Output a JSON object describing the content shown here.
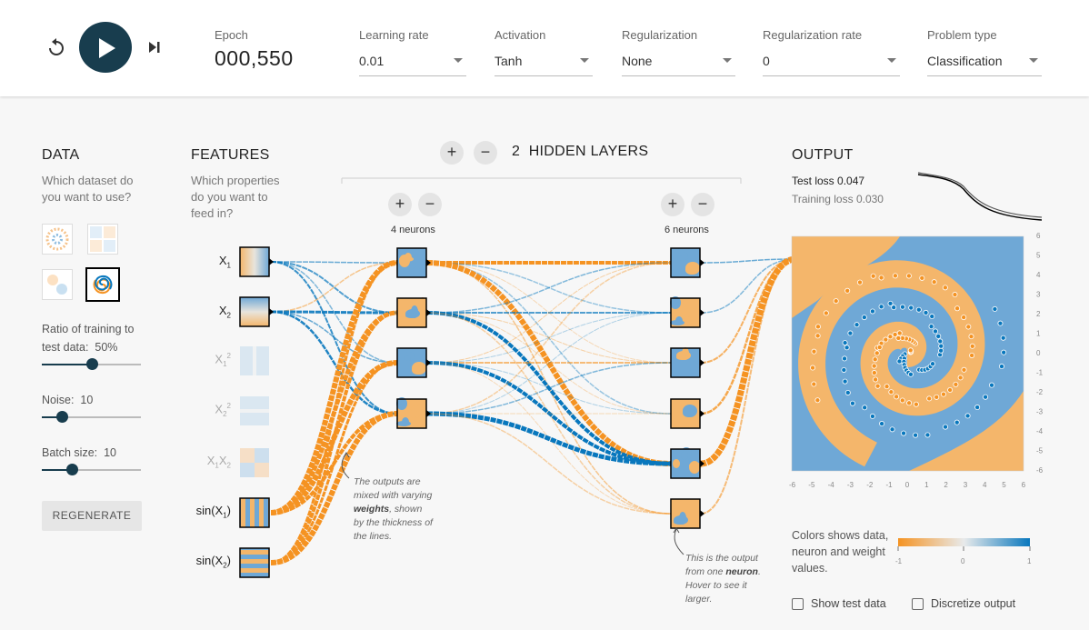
{
  "controls": {
    "epoch_label": "Epoch",
    "epoch_value": "000,550",
    "learning_rate": {
      "label": "Learning rate",
      "value": "0.01"
    },
    "activation": {
      "label": "Activation",
      "value": "Tanh"
    },
    "regularization": {
      "label": "Regularization",
      "value": "None"
    },
    "regularization_rate": {
      "label": "Regularization rate",
      "value": "0"
    },
    "problem_type": {
      "label": "Problem type",
      "value": "Classification"
    }
  },
  "data_panel": {
    "title": "DATA",
    "subtitle_line1": "Which dataset do",
    "subtitle_line2": "you want to use?",
    "datasets": [
      "circle",
      "xor",
      "gaussian",
      "spiral"
    ],
    "selected_dataset": "spiral",
    "ratio_label": "Ratio of training to",
    "ratio_label2": "test data:",
    "ratio_value": "50%",
    "ratio_fraction": 0.5,
    "noise_label": "Noise:",
    "noise_value": "10",
    "noise_fraction": 0.2,
    "batch_label": "Batch size:",
    "batch_value": "10",
    "batch_fraction": 0.3,
    "regenerate_label": "REGENERATE"
  },
  "features_panel": {
    "title": "FEATURES",
    "subtitle_line1": "Which properties",
    "subtitle_line2": "do you want to",
    "subtitle_line3": "feed in?",
    "features": [
      {
        "name": "X",
        "sub": "1",
        "sup": "",
        "active": true
      },
      {
        "name": "X",
        "sub": "2",
        "sup": "",
        "active": true
      },
      {
        "name": "X",
        "sub": "1",
        "sup": "2",
        "active": false
      },
      {
        "name": "X",
        "sub": "2",
        "sup": "2",
        "active": false
      },
      {
        "name": "X",
        "sub": "1",
        "name2": "X",
        "sub2": "2",
        "active": false
      },
      {
        "name": "sin(X",
        "sub": "1",
        "tail": ")",
        "active": true
      },
      {
        "name": "sin(X",
        "sub": "2",
        "tail": ")",
        "active": true
      }
    ]
  },
  "network": {
    "hidden_layers_count": "2",
    "hidden_layers_label": "HIDDEN LAYERS",
    "layer1_neurons": "4 neurons",
    "layer2_neurons": "6 neurons",
    "note_weights": {
      "line1": "The outputs are",
      "line2": "mixed with varying",
      "bold": "weights",
      "line3": ", shown",
      "line4": "by the thickness of",
      "line5": "the lines."
    },
    "note_neuron": {
      "line1": "This is the output",
      "line2": "from one",
      "bold": "neuron",
      "line3": ". Hover to see it",
      "line4": "larger."
    }
  },
  "output_panel": {
    "title": "OUTPUT",
    "test_loss_label": "Test loss",
    "test_loss_value": "0.047",
    "training_loss_label": "Training loss",
    "training_loss_value": "0.030",
    "y_ticks": [
      "6",
      "5",
      "4",
      "3",
      "2",
      "1",
      "0",
      "-1",
      "-2",
      "-3",
      "-4",
      "-5",
      "-6"
    ],
    "x_ticks": [
      "-6",
      "-5",
      "-4",
      "-3",
      "-2",
      "-1",
      "0",
      "1",
      "2",
      "3",
      "4",
      "5",
      "6"
    ],
    "legend_text": "Colors shows data, neuron and weight values.",
    "legend_min": "-1",
    "legend_mid": "0",
    "legend_max": "1",
    "show_test_data_label": "Show test data",
    "discretize_label": "Discretize output"
  },
  "colors": {
    "orange": "#f59322",
    "blue": "#0877bd",
    "region_orange": "#f4b66b",
    "region_blue": "#6fa8d6",
    "dark": "#183d4e"
  }
}
